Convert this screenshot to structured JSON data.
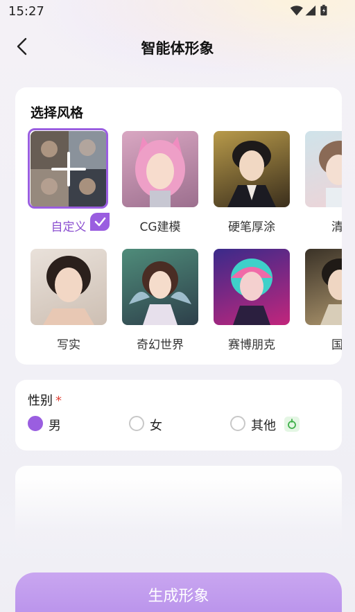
{
  "status_bar": {
    "time": "15:27"
  },
  "header": {
    "title": "智能体形象"
  },
  "styles_section": {
    "title": "选择风格",
    "items": [
      {
        "label": "自定义",
        "selected": true
      },
      {
        "label": "CG建模",
        "selected": false
      },
      {
        "label": "硬笔厚涂",
        "selected": false
      },
      {
        "label": "清新",
        "selected": false
      },
      {
        "label": "写实",
        "selected": false
      },
      {
        "label": "奇幻世界",
        "selected": false
      },
      {
        "label": "赛博朋克",
        "selected": false
      },
      {
        "label": "国风",
        "selected": false
      }
    ]
  },
  "gender_section": {
    "title": "性别",
    "required_mark": "*",
    "options": [
      {
        "label": "男",
        "selected": true
      },
      {
        "label": "女",
        "selected": false
      },
      {
        "label": "其他",
        "selected": false
      }
    ]
  },
  "footer": {
    "generate_label": "生成形象"
  },
  "colors": {
    "accent": "#9a5ee0",
    "required": "#e0453a"
  }
}
